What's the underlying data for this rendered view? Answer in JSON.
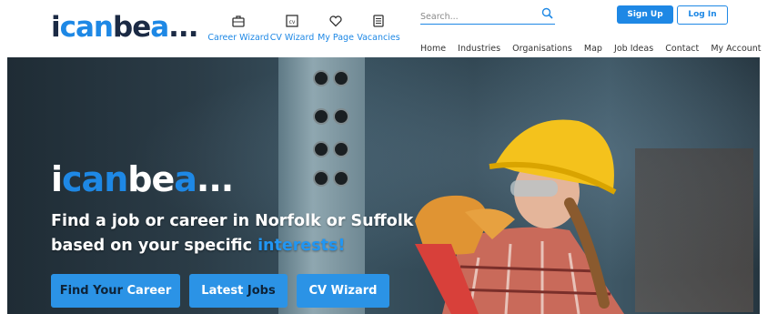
{
  "logo": {
    "part1": "i",
    "part2": "can",
    "part3": "be",
    "part4": "a",
    "dots": "..."
  },
  "nav_icons": [
    {
      "label": "Career Wizard",
      "icon": "briefcase-icon"
    },
    {
      "label": "CV Wizard",
      "icon": "cv-document-icon"
    },
    {
      "label": "My Page",
      "icon": "heart-icon"
    },
    {
      "label": "Vacancies",
      "icon": "list-document-icon"
    }
  ],
  "search": {
    "placeholder": "Search..."
  },
  "auth": {
    "signup": "Sign Up",
    "login": "Log In"
  },
  "topnav": [
    "Home",
    "Industries",
    "Organisations",
    "Map",
    "Job Ideas",
    "Contact",
    "My Account"
  ],
  "hero": {
    "line1": "Find a job or career in Norfolk or Suffolk",
    "line2_prefix": "based on your specific ",
    "line2_highlight": "interests!"
  },
  "cta": [
    {
      "part1": "Find Your ",
      "part2": "Career"
    },
    {
      "part1": "Latest ",
      "part2": "Jobs"
    },
    {
      "part1": "CV Wizard",
      "part2": ""
    }
  ],
  "colors": {
    "brand_blue": "#1e88e5",
    "brand_dark": "#1b2a44"
  }
}
